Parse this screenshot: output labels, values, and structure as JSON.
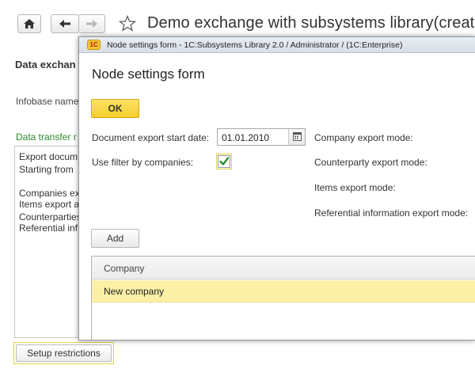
{
  "main": {
    "title": "Demo exchange with subsystems library(creatin",
    "section_heading": "Data exchan",
    "infobase_label": "Infobase name",
    "data_transfer_label": "Data transfer r",
    "description_lines": [
      "Export docum",
      "Starting from",
      "",
      "Companies ex",
      "Items export a",
      "Counterparties",
      "Referential inf"
    ],
    "setup_restrictions_label": "Setup restrictions"
  },
  "dialog": {
    "window_caption": "Node settings form - 1C:Subsystems Library 2.0 / Administrator /   (1C:Enterprise)",
    "app_icon_text": "1C",
    "heading": "Node settings form",
    "ok_label": "OK",
    "export_start_date_label": "Document export start date:",
    "export_start_date_value": "01.01.2010",
    "use_filter_label": "Use filter by companies:",
    "use_filter_checked": true,
    "company_export_mode_label": "Company export mode:",
    "counterparty_export_mode_label": "Counterparty export mode:",
    "items_export_mode_label": "Items export mode:",
    "referential_export_mode_label": "Referential information export mode:",
    "add_label": "Add",
    "table": {
      "columns": [
        "Company"
      ],
      "rows": [
        [
          "New company"
        ]
      ]
    }
  },
  "colors": {
    "accent_yellow": "#f4cf2b",
    "selected_row": "#fbf0a6",
    "green_label": "#2a8a2a",
    "checkmark": "#2e8b2e"
  }
}
